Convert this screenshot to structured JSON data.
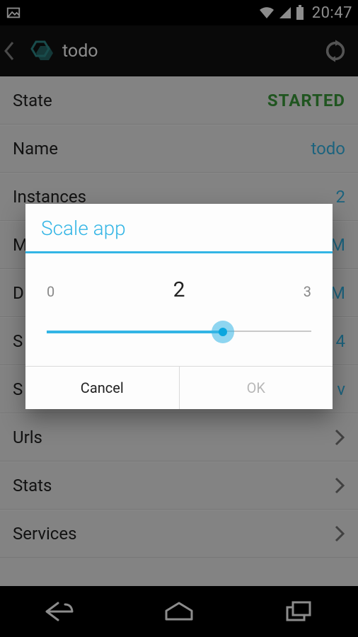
{
  "status": {
    "time": "20:47"
  },
  "actionbar": {
    "title": "todo"
  },
  "rows": {
    "state": {
      "label": "State",
      "value": "STARTED"
    },
    "name": {
      "label": "Name",
      "value": "todo"
    },
    "inst": {
      "label": "Instances",
      "value": "2"
    },
    "mem": {
      "label": "M",
      "value": "M"
    },
    "disk": {
      "label": "D",
      "value": "M"
    },
    "s1": {
      "label": "S",
      "value": "4"
    },
    "s2": {
      "label": "S",
      "value": "v"
    },
    "urls": {
      "label": "Urls"
    },
    "stats": {
      "label": "Stats"
    },
    "services": {
      "label": "Services"
    }
  },
  "dialog": {
    "title": "Scale app",
    "min": "0",
    "current": "2",
    "max": "3",
    "cancel": "Cancel",
    "ok": "OK"
  }
}
